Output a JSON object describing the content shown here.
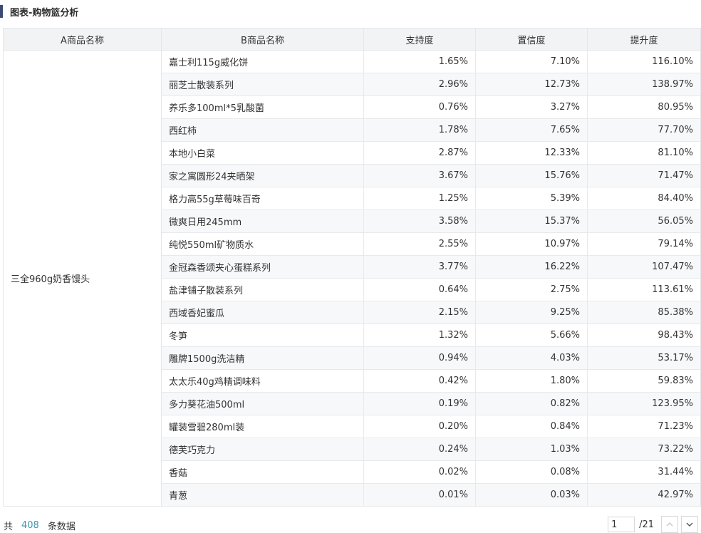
{
  "title": "图表-购物篮分析",
  "table": {
    "columns": [
      "A商品名称",
      "B商品名称",
      "支持度",
      "置信度",
      "提升度"
    ],
    "a_item": "三全960g奶香馒头",
    "rows": [
      [
        "嘉士利115g威化饼",
        "1.65%",
        "7.10%",
        "116.10%"
      ],
      [
        "丽芝士散装系列",
        "2.96%",
        "12.73%",
        "138.97%"
      ],
      [
        "养乐多100ml*5乳酸菌",
        "0.76%",
        "3.27%",
        "80.95%"
      ],
      [
        "西红柿",
        "1.78%",
        "7.65%",
        "77.70%"
      ],
      [
        "本地小白菜",
        "2.87%",
        "12.33%",
        "81.10%"
      ],
      [
        "家之寓圆形24夹晒架",
        "3.67%",
        "15.76%",
        "71.47%"
      ],
      [
        "格力高55g草莓味百奇",
        "1.25%",
        "5.39%",
        "84.40%"
      ],
      [
        "微爽日用245mm",
        "3.58%",
        "15.37%",
        "56.05%"
      ],
      [
        "纯悦550ml矿物质水",
        "2.55%",
        "10.97%",
        "79.14%"
      ],
      [
        "金冠森香颂夹心蛋糕系列",
        "3.77%",
        "16.22%",
        "107.47%"
      ],
      [
        "盐津铺子散装系列",
        "0.64%",
        "2.75%",
        "113.61%"
      ],
      [
        "西域香妃蜜瓜",
        "2.15%",
        "9.25%",
        "85.38%"
      ],
      [
        "冬笋",
        "1.32%",
        "5.66%",
        "98.43%"
      ],
      [
        "雕牌1500g洗洁精",
        "0.94%",
        "4.03%",
        "53.17%"
      ],
      [
        "太太乐40g鸡精调味料",
        "0.42%",
        "1.80%",
        "59.83%"
      ],
      [
        "多力葵花油500ml",
        "0.19%",
        "0.82%",
        "123.95%"
      ],
      [
        "罐装雪碧280ml装",
        "0.20%",
        "0.84%",
        "71.23%"
      ],
      [
        "德芙巧克力",
        "0.24%",
        "1.03%",
        "73.22%"
      ],
      [
        "香菇",
        "0.02%",
        "0.08%",
        "31.44%"
      ],
      [
        "青葱",
        "0.01%",
        "0.03%",
        "42.97%"
      ]
    ]
  },
  "footer": {
    "prefix": "共",
    "count": "408",
    "suffix": "条数据"
  },
  "pager": {
    "current": "1",
    "total": "/21",
    "prev_icon": "chevron-up-icon",
    "next_icon": "chevron-down-icon"
  },
  "colors": {
    "accent": "#3d4a78",
    "count": "#3a9aa7",
    "header_bg": "#f2f3f5",
    "alt_row_bg": "#f7f8fa"
  }
}
